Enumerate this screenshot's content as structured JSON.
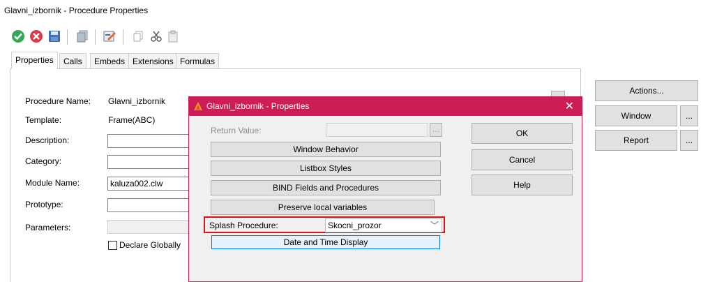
{
  "window": {
    "title": "Glavni_izbornik - Procedure Properties"
  },
  "toolbar": {
    "icons": [
      "ok-check-icon",
      "cancel-x-icon",
      "save-disk-icon",
      "copy-doc-icon",
      "edit-pencil-icon",
      "copy-icon",
      "cut-scissors-icon",
      "paste-icon"
    ]
  },
  "tabs": {
    "properties": "Properties",
    "calls": "Calls",
    "embeds": "Embeds",
    "extensions": "Extensions",
    "formulas": "Formulas"
  },
  "form": {
    "procedure_name_label": "Procedure Name:",
    "procedure_name_value": "Glavni_izbornik",
    "template_label": "Template:",
    "template_value": "Frame(ABC)",
    "description_label": "Description:",
    "description_value": "",
    "category_label": "Category:",
    "category_value": "",
    "module_name_label": "Module Name:",
    "module_name_value": "kaluza002.clw",
    "prototype_label": "Prototype:",
    "prototype_value": "",
    "parameters_label": "Parameters:",
    "parameters_value": "",
    "declare_globally_label": "Declare Globally",
    "declare_globally_checked": false
  },
  "right_buttons": {
    "actions": "Actions...",
    "window": "Window",
    "report": "Report",
    "more": "..."
  },
  "dialog": {
    "title": "Glavni_izbornik - Properties",
    "close": "✕",
    "return_value_label": "Return Value:",
    "return_value": "",
    "browse": "...",
    "window_behavior": "Window Behavior",
    "listbox_styles": "Listbox Styles",
    "bind_fields": "BIND Fields and Procedures",
    "preserve_local": "Preserve local variables",
    "splash_label": "Splash Procedure:",
    "splash_value": "Skocni_prozor",
    "date_time_display": "Date and Time Display",
    "ok": "OK",
    "cancel": "Cancel",
    "help": "Help"
  },
  "colors": {
    "dialog_title": "#cc1e55",
    "highlight_box": "#e01010"
  }
}
